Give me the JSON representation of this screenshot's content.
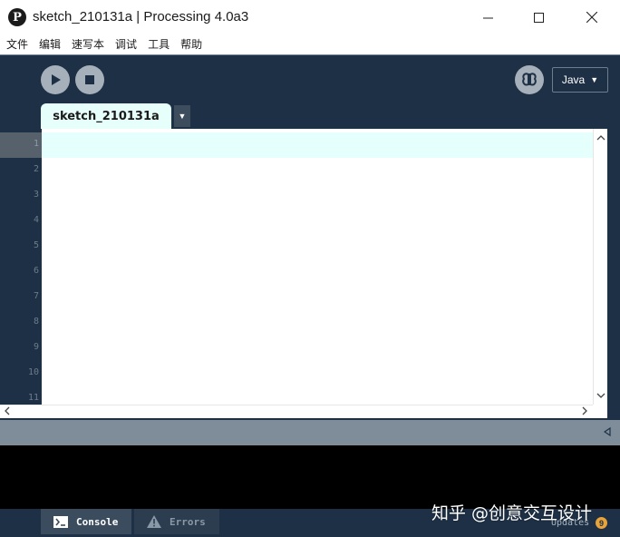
{
  "window": {
    "title": "sketch_210131a | Processing 4.0a3",
    "logo_glyph": "P"
  },
  "menu": [
    "文件",
    "编辑",
    "速写本",
    "调试",
    "工具",
    "帮助"
  ],
  "toolbar": {
    "mode": "Java",
    "mode_caret": "▼"
  },
  "tabs": [
    {
      "label": "sketch_210131a"
    }
  ],
  "tab_menu_caret": "▼",
  "editor": {
    "line_numbers": [
      "1",
      "2",
      "3",
      "4",
      "5",
      "6",
      "7",
      "8",
      "9",
      "10",
      "11"
    ],
    "current_line": "1"
  },
  "footer": {
    "console_label": "Console",
    "errors_label": "Errors",
    "updates_label": "Updates",
    "updates_count": "9"
  },
  "watermark": "知乎 @创意交互设计",
  "colors": {
    "frame": "#1e3045",
    "current_line": "#e5fffd",
    "badge": "#e8a33b"
  }
}
